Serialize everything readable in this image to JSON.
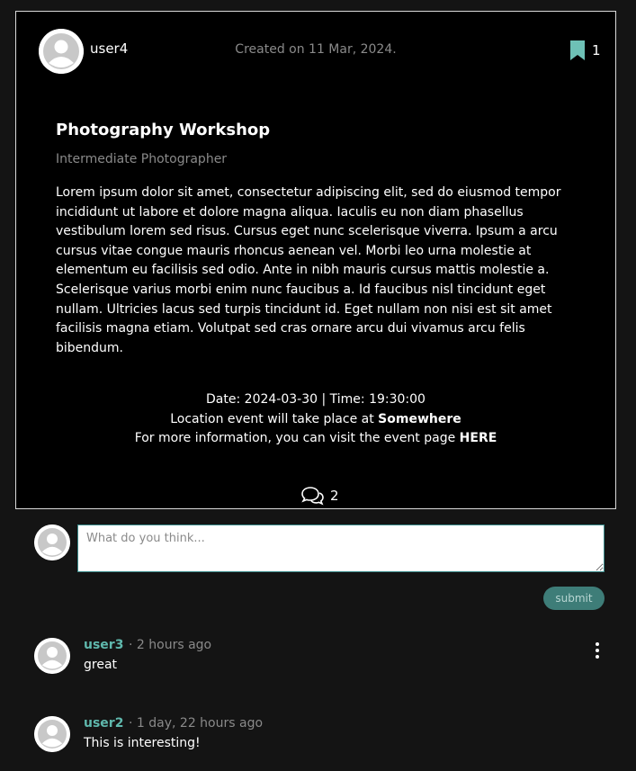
{
  "post": {
    "author": "user4",
    "created": "Created on 11 Mar, 2024.",
    "bookmark_count": "1",
    "title": "Photography Workshop",
    "subtitle": "Intermediate Photographer",
    "body": "Lorem ipsum dolor sit amet, consectetur adipiscing elit, sed do eiusmod tempor incididunt ut labore et dolore magna aliqua. Iaculis eu non diam phasellus vestibulum lorem sed risus. Cursus eget nunc scelerisque viverra. Ipsum a arcu cursus vitae congue mauris rhoncus aenean vel. Morbi leo urna molestie at elementum eu facilisis sed odio. Ante in nibh mauris cursus mattis molestie a. Scelerisque varius morbi enim nunc faucibus a. Id faucibus nisl tincidunt eget nullam. Ultricies lacus sed turpis tincidunt id. Eget nullam non nisi est sit amet facilisis magna etiam. Volutpat sed cras ornare arcu dui vivamus arcu felis bibendum.",
    "date_time": "Date: 2024-03-30 | Time: 19:30:00",
    "location_prefix": "Location event will take place at ",
    "location": "Somewhere",
    "info_prefix": "For more information, you can visit the event page ",
    "info_link": "HERE",
    "comment_count": "2"
  },
  "new_comment": {
    "placeholder": "What do you think...",
    "submit_label": "submit"
  },
  "comments": [
    {
      "user": "user3",
      "time": "· 2 hours ago",
      "text": "great"
    },
    {
      "user": "user2",
      "time": "· 1 day, 22 hours ago",
      "text": "This is interesting!"
    }
  ],
  "colors": {
    "accent": "#5fb8ad",
    "submit_bg": "#3e7d78",
    "bookmark": "#6ec1b6"
  },
  "icons": {
    "bookmark": "bookmark-icon",
    "comments": "comments-icon",
    "avatar": "avatar-icon",
    "menu": "kebab-menu-icon"
  }
}
